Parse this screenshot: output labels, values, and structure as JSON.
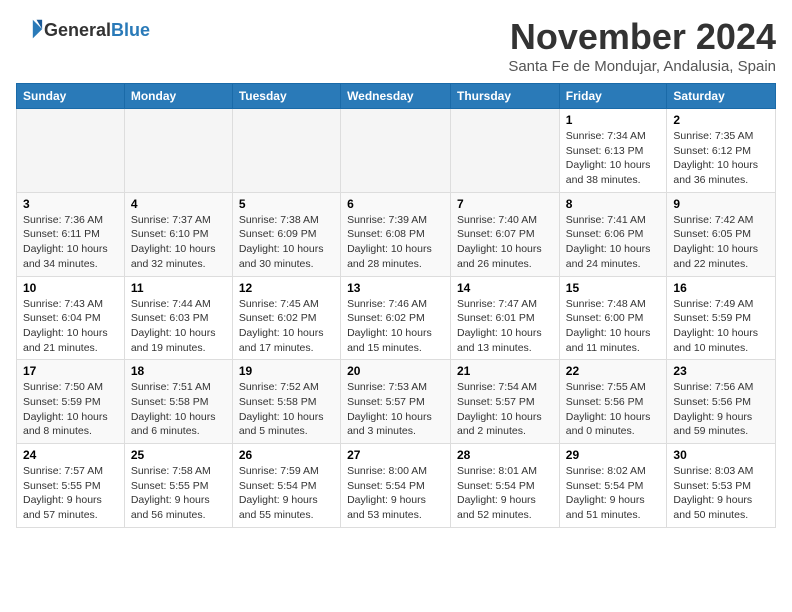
{
  "header": {
    "logo_general": "General",
    "logo_blue": "Blue",
    "month_title": "November 2024",
    "subtitle": "Santa Fe de Mondujar, Andalusia, Spain"
  },
  "weekdays": [
    "Sunday",
    "Monday",
    "Tuesday",
    "Wednesday",
    "Thursday",
    "Friday",
    "Saturday"
  ],
  "weeks": [
    {
      "days": [
        {
          "number": "",
          "info": ""
        },
        {
          "number": "",
          "info": ""
        },
        {
          "number": "",
          "info": ""
        },
        {
          "number": "",
          "info": ""
        },
        {
          "number": "",
          "info": ""
        },
        {
          "number": "1",
          "info": "Sunrise: 7:34 AM\nSunset: 6:13 PM\nDaylight: 10 hours and 38 minutes."
        },
        {
          "number": "2",
          "info": "Sunrise: 7:35 AM\nSunset: 6:12 PM\nDaylight: 10 hours and 36 minutes."
        }
      ]
    },
    {
      "days": [
        {
          "number": "3",
          "info": "Sunrise: 7:36 AM\nSunset: 6:11 PM\nDaylight: 10 hours and 34 minutes."
        },
        {
          "number": "4",
          "info": "Sunrise: 7:37 AM\nSunset: 6:10 PM\nDaylight: 10 hours and 32 minutes."
        },
        {
          "number": "5",
          "info": "Sunrise: 7:38 AM\nSunset: 6:09 PM\nDaylight: 10 hours and 30 minutes."
        },
        {
          "number": "6",
          "info": "Sunrise: 7:39 AM\nSunset: 6:08 PM\nDaylight: 10 hours and 28 minutes."
        },
        {
          "number": "7",
          "info": "Sunrise: 7:40 AM\nSunset: 6:07 PM\nDaylight: 10 hours and 26 minutes."
        },
        {
          "number": "8",
          "info": "Sunrise: 7:41 AM\nSunset: 6:06 PM\nDaylight: 10 hours and 24 minutes."
        },
        {
          "number": "9",
          "info": "Sunrise: 7:42 AM\nSunset: 6:05 PM\nDaylight: 10 hours and 22 minutes."
        }
      ]
    },
    {
      "days": [
        {
          "number": "10",
          "info": "Sunrise: 7:43 AM\nSunset: 6:04 PM\nDaylight: 10 hours and 21 minutes."
        },
        {
          "number": "11",
          "info": "Sunrise: 7:44 AM\nSunset: 6:03 PM\nDaylight: 10 hours and 19 minutes."
        },
        {
          "number": "12",
          "info": "Sunrise: 7:45 AM\nSunset: 6:02 PM\nDaylight: 10 hours and 17 minutes."
        },
        {
          "number": "13",
          "info": "Sunrise: 7:46 AM\nSunset: 6:02 PM\nDaylight: 10 hours and 15 minutes."
        },
        {
          "number": "14",
          "info": "Sunrise: 7:47 AM\nSunset: 6:01 PM\nDaylight: 10 hours and 13 minutes."
        },
        {
          "number": "15",
          "info": "Sunrise: 7:48 AM\nSunset: 6:00 PM\nDaylight: 10 hours and 11 minutes."
        },
        {
          "number": "16",
          "info": "Sunrise: 7:49 AM\nSunset: 5:59 PM\nDaylight: 10 hours and 10 minutes."
        }
      ]
    },
    {
      "days": [
        {
          "number": "17",
          "info": "Sunrise: 7:50 AM\nSunset: 5:59 PM\nDaylight: 10 hours and 8 minutes."
        },
        {
          "number": "18",
          "info": "Sunrise: 7:51 AM\nSunset: 5:58 PM\nDaylight: 10 hours and 6 minutes."
        },
        {
          "number": "19",
          "info": "Sunrise: 7:52 AM\nSunset: 5:58 PM\nDaylight: 10 hours and 5 minutes."
        },
        {
          "number": "20",
          "info": "Sunrise: 7:53 AM\nSunset: 5:57 PM\nDaylight: 10 hours and 3 minutes."
        },
        {
          "number": "21",
          "info": "Sunrise: 7:54 AM\nSunset: 5:57 PM\nDaylight: 10 hours and 2 minutes."
        },
        {
          "number": "22",
          "info": "Sunrise: 7:55 AM\nSunset: 5:56 PM\nDaylight: 10 hours and 0 minutes."
        },
        {
          "number": "23",
          "info": "Sunrise: 7:56 AM\nSunset: 5:56 PM\nDaylight: 9 hours and 59 minutes."
        }
      ]
    },
    {
      "days": [
        {
          "number": "24",
          "info": "Sunrise: 7:57 AM\nSunset: 5:55 PM\nDaylight: 9 hours and 57 minutes."
        },
        {
          "number": "25",
          "info": "Sunrise: 7:58 AM\nSunset: 5:55 PM\nDaylight: 9 hours and 56 minutes."
        },
        {
          "number": "26",
          "info": "Sunrise: 7:59 AM\nSunset: 5:54 PM\nDaylight: 9 hours and 55 minutes."
        },
        {
          "number": "27",
          "info": "Sunrise: 8:00 AM\nSunset: 5:54 PM\nDaylight: 9 hours and 53 minutes."
        },
        {
          "number": "28",
          "info": "Sunrise: 8:01 AM\nSunset: 5:54 PM\nDaylight: 9 hours and 52 minutes."
        },
        {
          "number": "29",
          "info": "Sunrise: 8:02 AM\nSunset: 5:54 PM\nDaylight: 9 hours and 51 minutes."
        },
        {
          "number": "30",
          "info": "Sunrise: 8:03 AM\nSunset: 5:53 PM\nDaylight: 9 hours and 50 minutes."
        }
      ]
    }
  ]
}
